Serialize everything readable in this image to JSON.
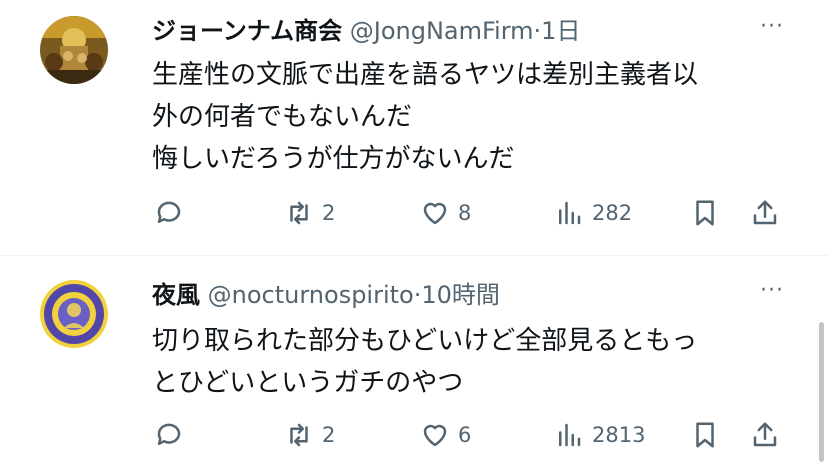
{
  "tweets": [
    {
      "name": "ジョーンナム商会",
      "handle": "@JongNamFirm",
      "dot": "·",
      "time": "1日",
      "more": "···",
      "lines": [
        "生産性の文脈で出産を語るヤツは差別主義者以",
        "外の何者でもないんだ",
        "悔しいだろうが仕方がないんだ"
      ],
      "replies": "",
      "retweets": "2",
      "likes": "8",
      "views": "282"
    },
    {
      "name": "夜風",
      "handle": "@nocturnospirito",
      "dot": "·",
      "time": "10時間",
      "more": "···",
      "lines": [
        "切り取られた部分もひどいけど全部見るともっ",
        "とひどいというガチのやつ"
      ],
      "replies": "",
      "retweets": "2",
      "likes": "6",
      "views": "2813"
    }
  ]
}
